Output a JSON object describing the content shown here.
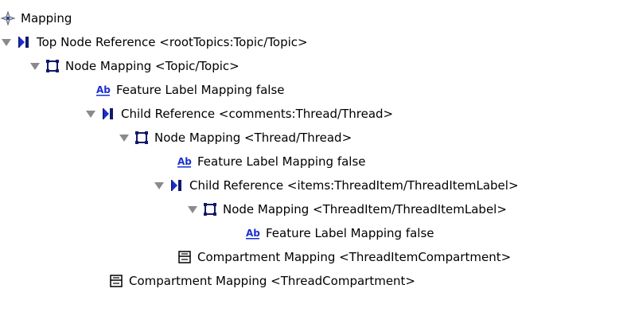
{
  "tree": {
    "nodes": [
      {
        "label": "Mapping",
        "icon": "mapping-icon",
        "depth": 0,
        "expanded": null
      },
      {
        "label": "Top Node Reference <rootTopics:Topic/Topic>",
        "icon": "reference-icon",
        "depth": 0,
        "expanded": true
      },
      {
        "label": "Node Mapping <Topic/Topic>",
        "icon": "node-mapping-icon",
        "depth": 1,
        "expanded": true
      },
      {
        "label": "Feature Label Mapping false",
        "icon": "label-mapping-icon",
        "depth": 2,
        "expanded": null
      },
      {
        "label": "Child Reference <comments:Thread/Thread>",
        "icon": "reference-icon",
        "depth": 2,
        "expanded": true
      },
      {
        "label": "Node Mapping <Thread/Thread>",
        "icon": "node-mapping-icon",
        "depth": 3,
        "expanded": true
      },
      {
        "label": "Feature Label Mapping false",
        "icon": "label-mapping-icon",
        "depth": 4,
        "expanded": null
      },
      {
        "label": "Child Reference <items:ThreadItem/ThreadItemLabel>",
        "icon": "reference-icon",
        "depth": 4,
        "expanded": true
      },
      {
        "label": "Node Mapping <ThreadItem/ThreadItemLabel>",
        "icon": "node-mapping-icon",
        "depth": 5,
        "expanded": true
      },
      {
        "label": "Feature Label Mapping false",
        "icon": "label-mapping-icon",
        "depth": 6,
        "expanded": null
      },
      {
        "label": "Compartment Mapping <ThreadItemCompartment>",
        "icon": "compartment-mapping-icon",
        "depth": 4,
        "expanded": null
      },
      {
        "label": "Compartment Mapping <ThreadCompartment>",
        "icon": "compartment-mapping-icon",
        "depth": 2,
        "expanded": null
      }
    ]
  },
  "colors": {
    "icon_blue": "#1a2fd0",
    "icon_navy": "#101a6b",
    "twisty_gray": "#8a8a8a"
  }
}
